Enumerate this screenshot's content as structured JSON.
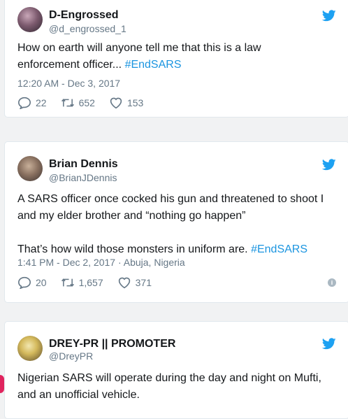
{
  "tweets": [
    {
      "display_name": "D-Engrossed",
      "handle": "@d_engrossed_1",
      "text_lines": [
        "How on earth will anyone tell me that this is a law",
        "enforcement officer... "
      ],
      "hashtag": "#EndSARS",
      "timestamp": "12:20 AM - Dec 3, 2017",
      "replies": "22",
      "retweets": "652",
      "likes": "153"
    },
    {
      "display_name": "Brian Dennis",
      "handle": "@BrianJDennis",
      "text_p1": "A SARS officer once cocked his gun and threatened to shoot I and my elder brother and “nothing go happen”",
      "text_p2": "That’s how wild those monsters in uniform are. ",
      "hashtag": "#EndSARS",
      "timestamp": "1:41 PM - Dec 2, 2017",
      "location": "Abuja, Nigeria",
      "replies": "20",
      "retweets": "1,657",
      "likes": "371"
    },
    {
      "display_name": "DREY-PR || PROMOTER",
      "handle": "@DreyPR",
      "text": "Nigerian SARS will operate during the day and night on Mufti, and an unofficial vehicle."
    }
  ],
  "colors": {
    "brand_blue": "#1da1f2",
    "hashtag": "#1b95e0",
    "muted": "#657786",
    "border": "#e1e8ed"
  },
  "icons": {
    "logo": "twitter-bird-icon",
    "reply": "reply-icon",
    "retweet": "retweet-icon",
    "like": "heart-icon",
    "info": "info-icon"
  }
}
